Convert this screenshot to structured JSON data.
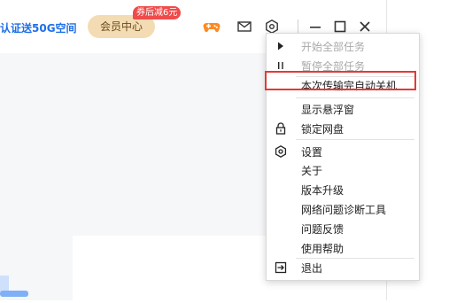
{
  "header": {
    "promo_text": "认证送50G空间",
    "vip_label": "会员中心",
    "coupon_badge": "券后减6元"
  },
  "icons": {
    "game": "game-controller-icon",
    "mail": "mail-icon",
    "settings": "gear-icon",
    "minimize": "minimize-icon",
    "maximize": "maximize-icon",
    "close": "close-icon"
  },
  "menu": {
    "items": [
      {
        "label": "开始全部任务",
        "icon": "play-icon",
        "disabled": true
      },
      {
        "label": "暂停全部任务",
        "icon": "pause-icon",
        "disabled": true
      },
      {
        "label": "本次传输完自动关机",
        "icon": "",
        "highlighted": true
      },
      {
        "label": "显示悬浮窗",
        "icon": ""
      },
      {
        "label": "锁定网盘",
        "icon": "lock-icon"
      },
      {
        "label": "设置",
        "icon": "gear-icon"
      },
      {
        "label": "关于",
        "icon": ""
      },
      {
        "label": "版本升级",
        "icon": ""
      },
      {
        "label": "网络问题诊断工具",
        "icon": ""
      },
      {
        "label": "问题反馈",
        "icon": ""
      },
      {
        "label": "使用帮助",
        "icon": ""
      },
      {
        "label": "退出",
        "icon": "exit-icon"
      }
    ]
  },
  "colors": {
    "accent_blue": "#1e6fe8",
    "vip_gold": "#f3dcb3",
    "badge_red": "#f04a4a",
    "game_orange": "#ff8a1f",
    "highlight_red": "#e53935"
  }
}
